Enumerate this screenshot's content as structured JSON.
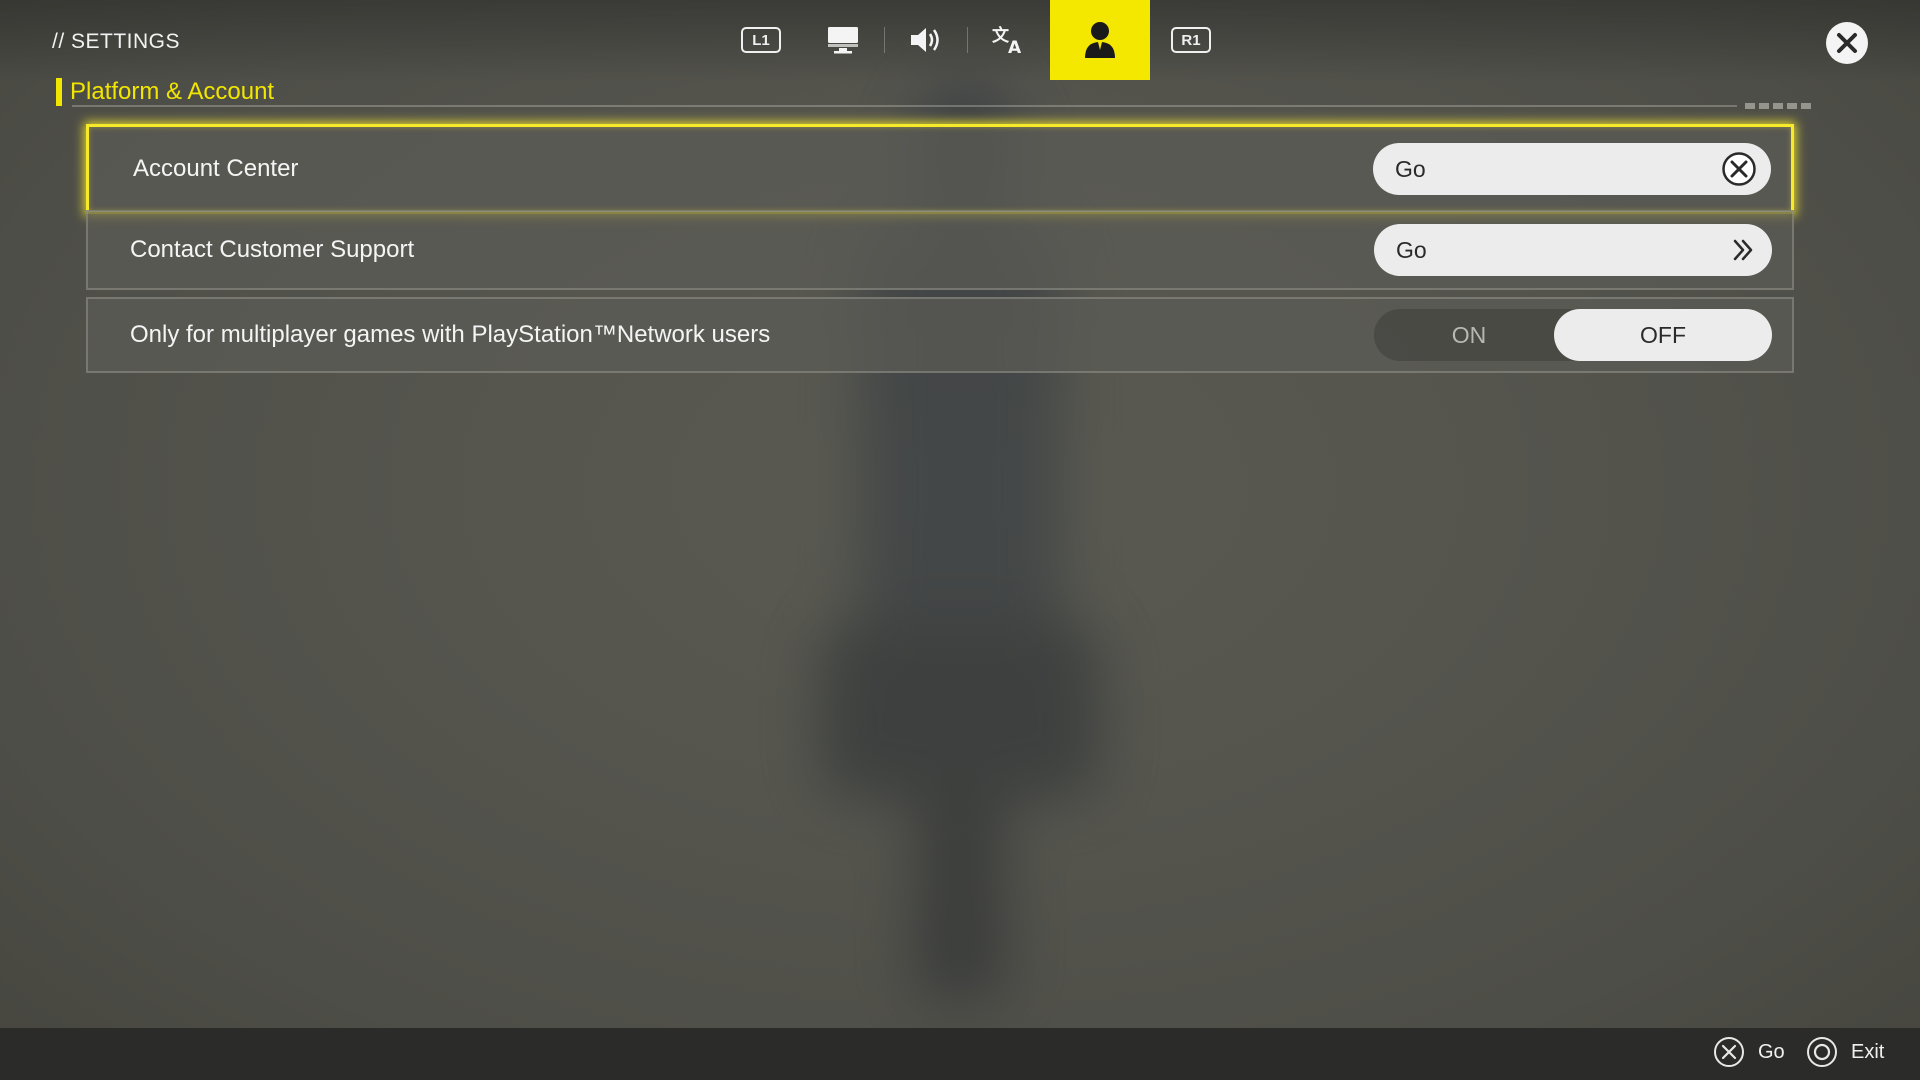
{
  "header": {
    "settings_label": "// SETTINGS",
    "section_title": "Platform & Account"
  },
  "tabs": {
    "left_bumper": "L1",
    "right_bumper": "R1",
    "items": [
      {
        "icon": "display-icon",
        "active": false
      },
      {
        "icon": "speaker-icon",
        "active": false
      },
      {
        "icon": "language-icon",
        "active": false
      },
      {
        "icon": "account-icon",
        "active": true
      }
    ]
  },
  "rows": [
    {
      "label": "Account Center",
      "control": "go",
      "button_label": "Go",
      "button_icon": "cross-button-icon",
      "selected": true
    },
    {
      "label": "Contact Customer Support",
      "control": "go",
      "button_label": "Go",
      "button_icon": "double-chevron-right-icon",
      "selected": false
    },
    {
      "label": "Only for multiplayer games with PlayStation™Network users",
      "control": "toggle",
      "on_label": "ON",
      "off_label": "OFF",
      "value": "OFF",
      "selected": false
    }
  ],
  "footer": {
    "go_label": "Go",
    "exit_label": "Exit"
  },
  "colors": {
    "accent": "#f5e800",
    "panel": "#5c5c56",
    "button": "#ececec"
  }
}
